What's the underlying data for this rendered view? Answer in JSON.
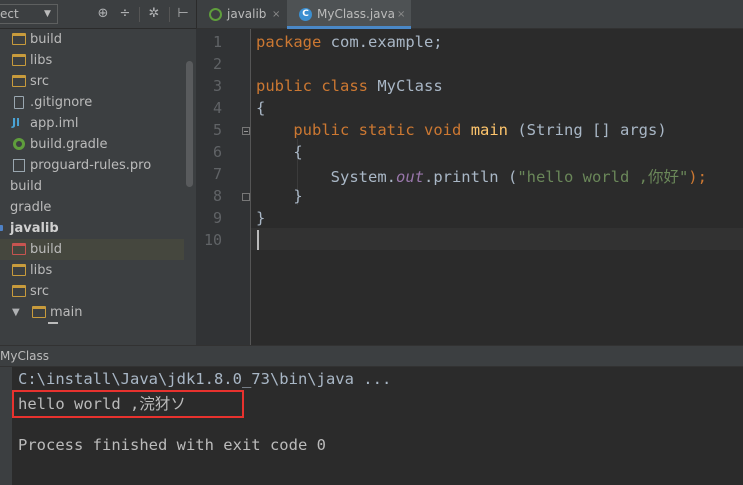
{
  "project_toolbar": {
    "view_selector": "ect",
    "icons": [
      "globe-target-icon",
      "collapse-all-icon",
      "gear-icon",
      "hide-panel-icon"
    ]
  },
  "tree": {
    "items": [
      {
        "label": "build",
        "icon": "folder-icon"
      },
      {
        "label": "libs",
        "icon": "folder-icon"
      },
      {
        "label": "src",
        "icon": "folder-icon"
      },
      {
        "label": ".gitignore",
        "icon": "file-icon"
      },
      {
        "label": "app.iml",
        "icon": "iml-file-icon"
      },
      {
        "label": "build.gradle",
        "icon": "gradle-file-icon"
      },
      {
        "label": "proguard-rules.pro",
        "icon": "properties-file-icon"
      },
      {
        "label": "build",
        "icon": "none"
      },
      {
        "label": "gradle",
        "icon": "none"
      },
      {
        "label": "javalib",
        "icon": "module-icon"
      },
      {
        "label": "build",
        "icon": "excluded-folder-icon"
      },
      {
        "label": "libs",
        "icon": "folder-icon"
      },
      {
        "label": "src",
        "icon": "folder-icon"
      },
      {
        "label": "main",
        "icon": "folder-icon"
      }
    ]
  },
  "tabs": [
    {
      "label": "javalib",
      "close": "×",
      "active": false
    },
    {
      "label": "MyClass.java",
      "close": "×",
      "active": true,
      "icon_letter": "C"
    }
  ],
  "editor": {
    "line_numbers": [
      "1",
      "2",
      "3",
      "4",
      "5",
      "6",
      "7",
      "8",
      "9",
      "10"
    ],
    "code": {
      "l1_kw": "package",
      "l1_rest": " com.example;",
      "l3_kw1": "public",
      "l3_kw2": "class",
      "l3_rest": " MyClass",
      "l4": "{",
      "l5_kw1": "public",
      "l5_kw2": "static",
      "l5_kw3": "void",
      "l5_fn": "main",
      "l5_rest": " (String [] args)",
      "l6": "{",
      "l7_a": "System.",
      "l7_out": "out",
      "l7_b": ".println (",
      "l7_str": "\"hello world ,你好\"",
      "l7_c": ");",
      "l8": "}",
      "l9": "}"
    }
  },
  "run_panel": {
    "title": "MyClass",
    "lines": [
      "C:\\install\\Java\\jdk1.8.0_73\\bin\\java ...",
      "hello world ,浣犲ソ",
      "",
      "Process finished with exit code 0"
    ]
  },
  "colors": {
    "keyword": "#cc7832",
    "function": "#ffc66d",
    "string": "#6a8759",
    "static_field": "#9876aa",
    "highlight_box": "#e8322e"
  }
}
